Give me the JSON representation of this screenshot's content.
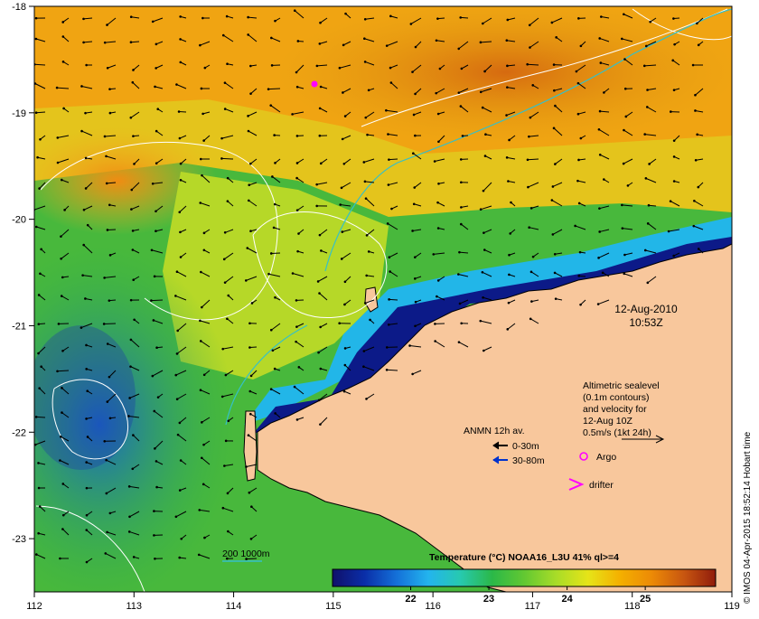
{
  "map": {
    "lon_ticks": [
      "112",
      "113",
      "114",
      "115",
      "116",
      "117",
      "118",
      "119"
    ],
    "lat_ticks": [
      "-18",
      "-19",
      "-20",
      "-21",
      "-22",
      "-23"
    ],
    "lon_range": [
      112,
      119
    ],
    "lat_range": [
      -18,
      -23.5
    ],
    "colors": {
      "land": "#f8c79c",
      "contour": "#ffffff",
      "isobath": "#35c0c8",
      "argo": "#ff00ff",
      "drifter": "#ff00ff",
      "arrow_0_30": "#000000",
      "arrow_30_80": "#0033cc"
    }
  },
  "stamp": {
    "date": "12-Aug-2010",
    "time": "10:53Z"
  },
  "altimetry": {
    "line1": "Altimetric sealevel",
    "line2": "(0.1m contours)",
    "line3": "and velocity for",
    "line4": "12-Aug 10Z",
    "line5": "0.5m/s (1kt 24h)"
  },
  "legend": {
    "anmn_title": "ANMN 12h av.",
    "anmn_0_30": "0-30m",
    "anmn_30_80": "30-80m",
    "argo": "Argo",
    "drifter": "drifter",
    "isobath": "200  1000m"
  },
  "colorbar": {
    "title": "Temperature (°C) NOAA16_L3U 41% ql>=4",
    "ticks": [
      "22",
      "23",
      "24",
      "25"
    ],
    "tick_values": [
      22,
      23,
      24,
      25
    ],
    "range": [
      21,
      25.9
    ],
    "stops": [
      "#10106a",
      "#0a2ea8",
      "#1470d8",
      "#23b4ee",
      "#27c9b0",
      "#2bb848",
      "#62c832",
      "#a8dc28",
      "#e6e418",
      "#f4b000",
      "#ec8a06",
      "#c85610",
      "#901c0c"
    ]
  },
  "credit": "© IMOS 04-Apr-2015 18:52:14 Hobart time"
}
